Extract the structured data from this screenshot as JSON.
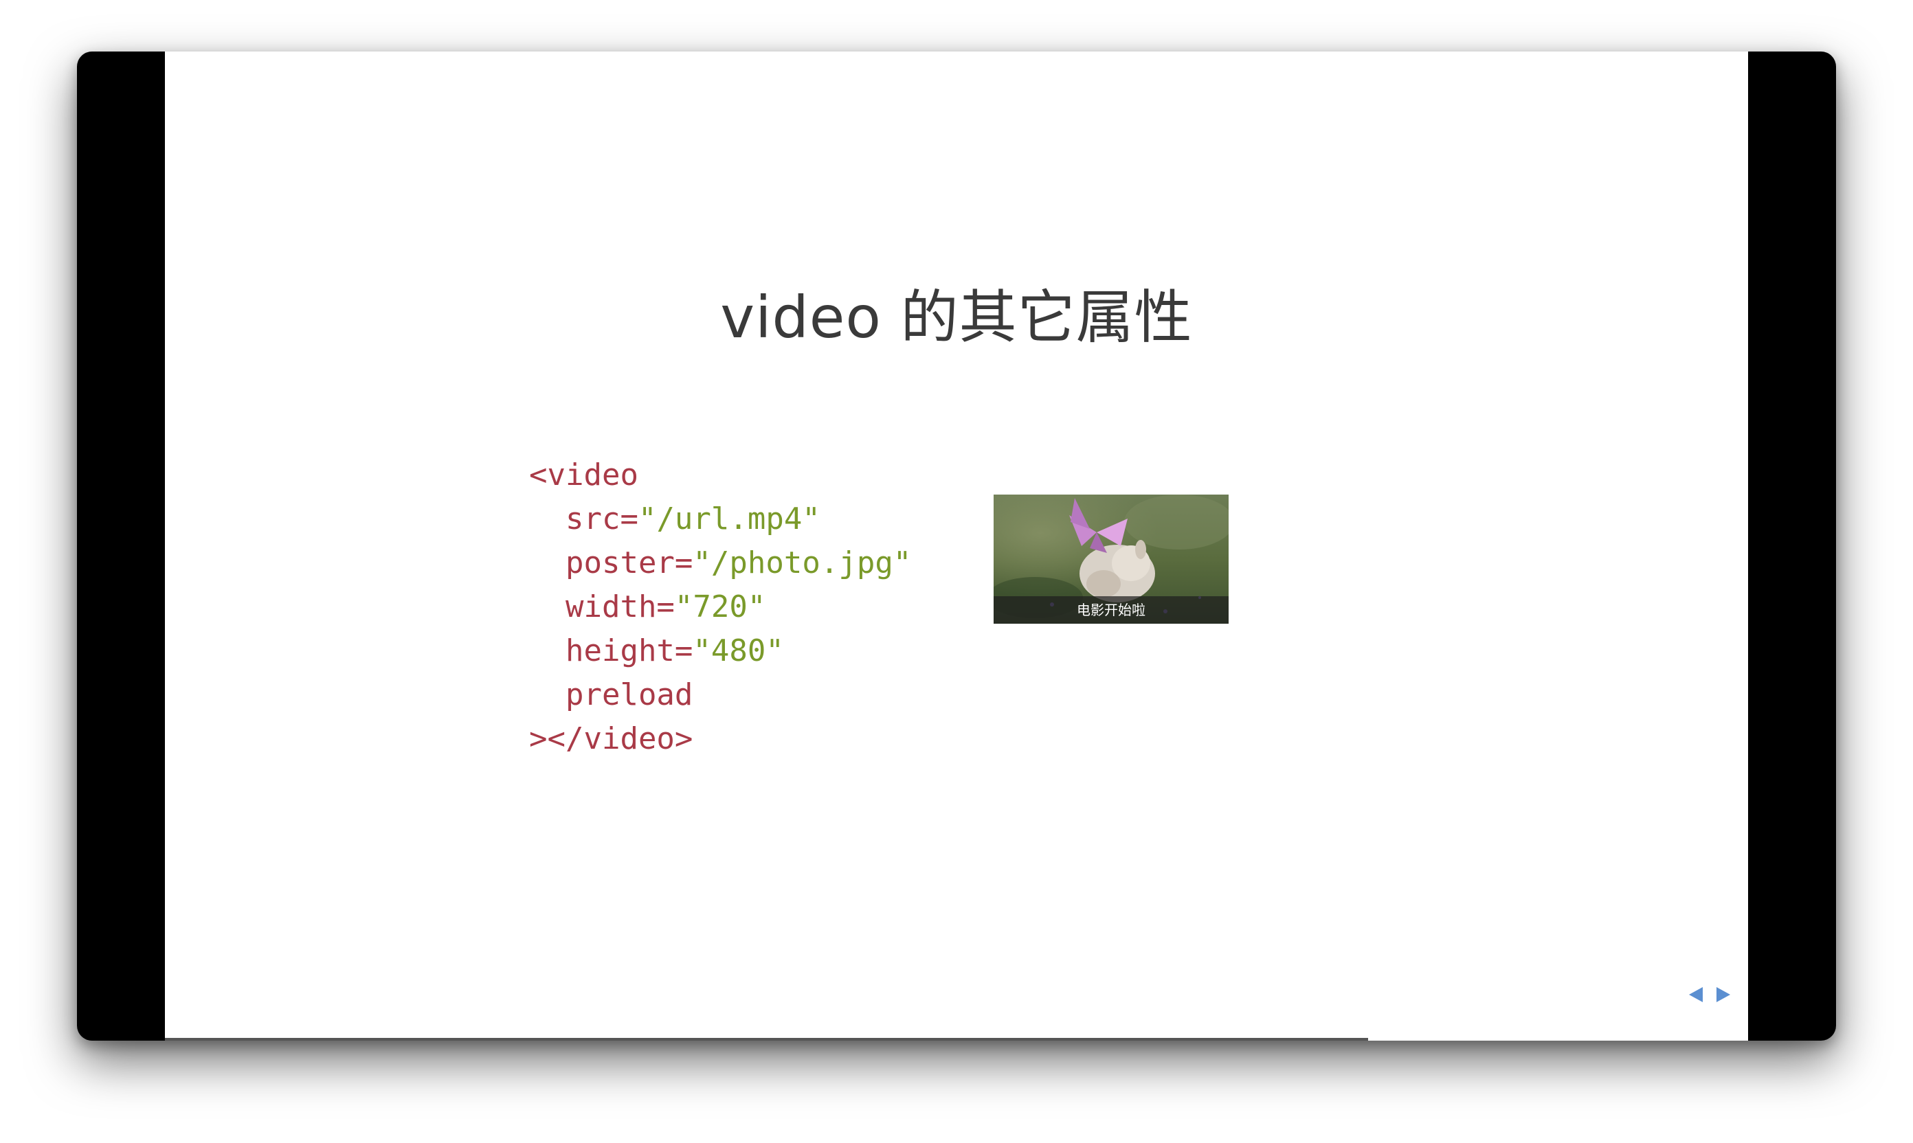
{
  "slide": {
    "title": "video 的其它属性",
    "code": {
      "line1": "<video",
      "src_attr": "  src=",
      "src_value": "\"/url.mp4\"",
      "poster_attr": "  poster=",
      "poster_value": "\"/photo.jpg\"",
      "width_attr": "  width=",
      "width_value": "\"720\"",
      "height_attr": "  height=",
      "height_value": "\"480\"",
      "preload": "  preload",
      "close": "></video>"
    },
    "preview": {
      "subtitle": "电影开始啦"
    },
    "progress_fraction": 0.76
  },
  "controls": {
    "prev_icon": "triangle-left-icon",
    "next_icon": "triangle-right-icon",
    "color": "#5b8fd1"
  },
  "colors": {
    "code_tag": "#a93a47",
    "code_string": "#7a9a2a",
    "title": "#3a3a3a"
  }
}
